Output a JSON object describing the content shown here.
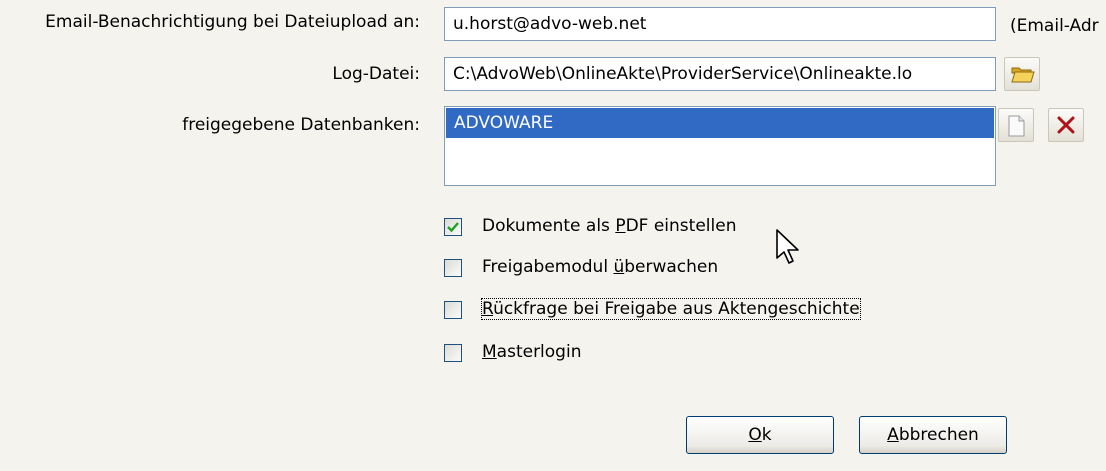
{
  "email": {
    "label": "Email-Benachrichtigung bei Dateiupload an:",
    "value": "u.horst@advo-web.net",
    "hint": "(Email-Adr"
  },
  "logfile": {
    "label": "Log-Datei:",
    "value": "C:\\AdvoWeb\\OnlineAkte\\ProviderService\\Onlineakte.lo"
  },
  "databases": {
    "label": "freigegebene Datenbanken:",
    "items": [
      "ADVOWARE"
    ]
  },
  "options": [
    {
      "pre": "Dokumente als ",
      "key": "P",
      "post": "DF einstellen",
      "checked": true
    },
    {
      "pre": "Freigabemodul ",
      "key": "ü",
      "post": "berwachen",
      "checked": false
    },
    {
      "pre": "",
      "key": "R",
      "post": "ückfrage bei Freigabe aus Aktengeschichte",
      "checked": false
    },
    {
      "pre": "",
      "key": "M",
      "post": "asterlogin",
      "checked": false
    }
  ],
  "buttons": {
    "ok": {
      "key": "O",
      "rest": "k"
    },
    "cancel": {
      "key": "A",
      "rest": "bbrechen"
    }
  },
  "icons": {
    "browse": "folder-open-icon",
    "new": "new-document-icon",
    "delete": "delete-x-icon"
  },
  "colors": {
    "background": "#f4f3ee",
    "selection": "#316ac5",
    "border": "#7f9db9"
  }
}
